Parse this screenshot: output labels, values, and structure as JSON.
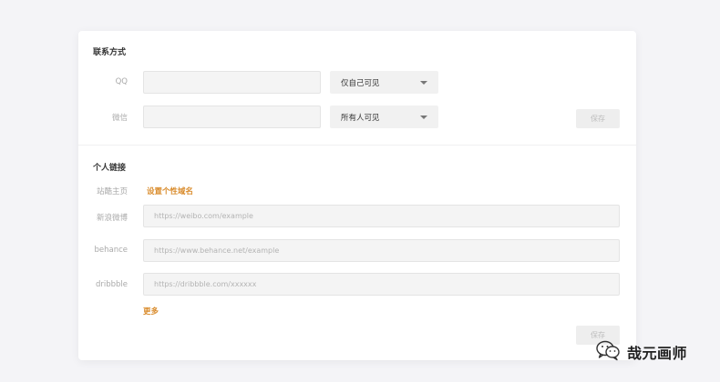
{
  "contact": {
    "title": "联系方式",
    "qq": {
      "label": "QQ",
      "value": "",
      "visibility": "仅自己可见"
    },
    "wechat": {
      "label": "微信",
      "value": "",
      "visibility": "所有人可见"
    },
    "save_label": "保存"
  },
  "links": {
    "title": "个人链接",
    "homepage": {
      "label": "站酷主页",
      "action": "设置个性域名"
    },
    "weibo": {
      "label": "新浪微博",
      "placeholder": "https://weibo.com/example"
    },
    "behance": {
      "label": "behance",
      "placeholder": "https://www.behance.net/example"
    },
    "dribbble": {
      "label": "dribbble",
      "placeholder": "https://dribbble.com/xxxxxx"
    },
    "more_label": "更多",
    "save_label": "保存"
  },
  "watermark": {
    "text": "哉元画师",
    "icon": "wechat-icon"
  },
  "colors": {
    "accent": "#d98b2b",
    "background": "#f4f4f7",
    "card": "#ffffff"
  }
}
